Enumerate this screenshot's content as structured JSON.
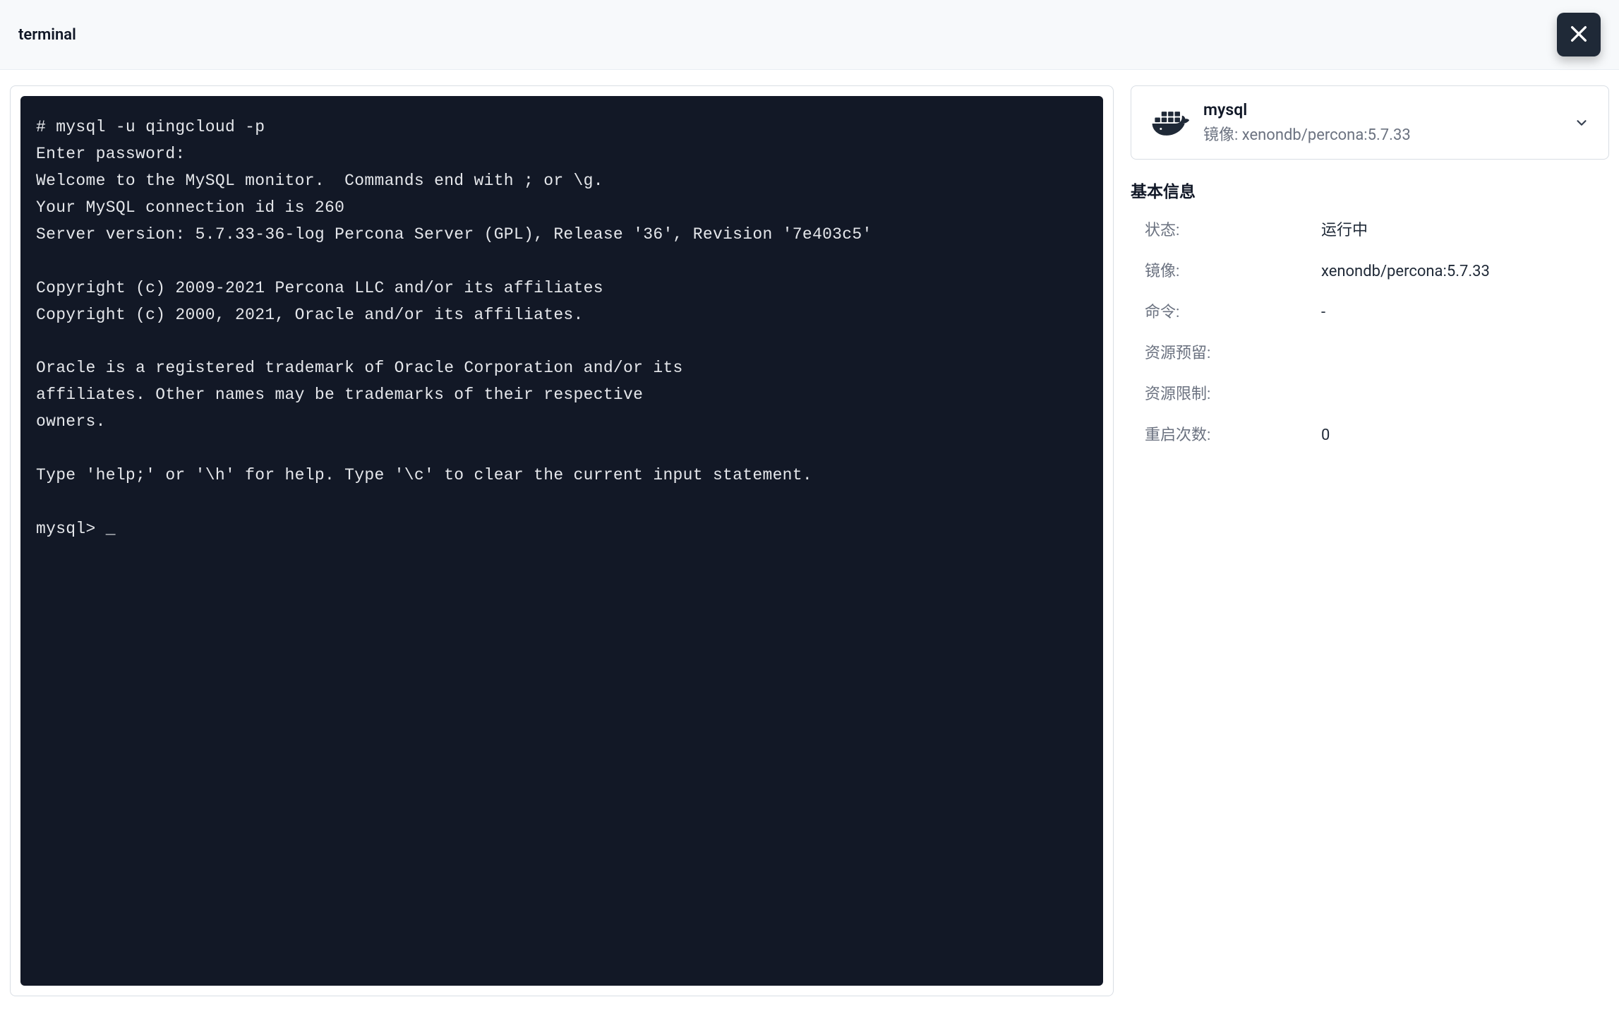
{
  "header": {
    "title": "terminal"
  },
  "terminal": {
    "output": "# mysql -u qingcloud -p\nEnter password:\nWelcome to the MySQL monitor.  Commands end with ; or \\g.\nYour MySQL connection id is 260\nServer version: 5.7.33-36-log Percona Server (GPL), Release '36', Revision '7e403c5'\n\nCopyright (c) 2009-2021 Percona LLC and/or its affiliates\nCopyright (c) 2000, 2021, Oracle and/or its affiliates.\n\nOracle is a registered trademark of Oracle Corporation and/or its\naffiliates. Other names may be trademarks of their respective\nowners.\n\nType 'help;' or '\\h' for help. Type '\\c' to clear the current input statement.\n\nmysql> _"
  },
  "sidebar": {
    "container_card": {
      "title": "mysql",
      "sub_prefix": "镜像: ",
      "sub_value": "xenondb/percona:5.7.33",
      "icon": "docker-icon"
    },
    "section_title": "基本信息",
    "rows": [
      {
        "label": "状态:",
        "value": "运行中"
      },
      {
        "label": "镜像:",
        "value": "xenondb/percona:5.7.33"
      },
      {
        "label": "命令:",
        "value": "-"
      },
      {
        "label": "资源预留:",
        "value": ""
      },
      {
        "label": "资源限制:",
        "value": ""
      },
      {
        "label": "重启次数:",
        "value": "0"
      }
    ]
  }
}
